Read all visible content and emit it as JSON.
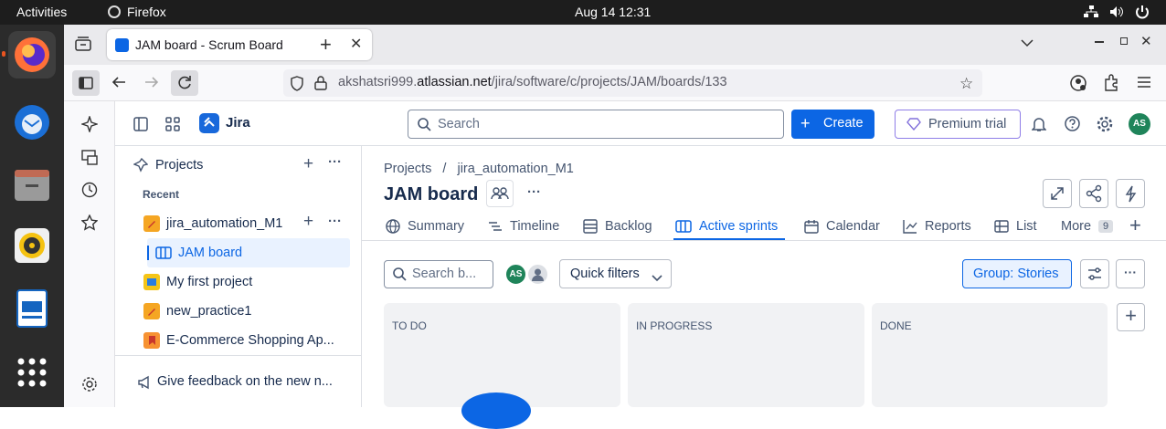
{
  "system": {
    "activities": "Activities",
    "app_name": "Firefox",
    "datetime": "Aug 14  12:31"
  },
  "browser": {
    "tab_title": "JAM board - Scrum Board",
    "url_domain": "akshatsri999.",
    "url_host": "atlassian.net",
    "url_path": "/jira/software/c/projects/JAM/boards/133"
  },
  "jira": {
    "product": "Jira",
    "search_placeholder": "Search",
    "create_label": "Create",
    "premium_label": "Premium trial",
    "avatar_initials": "AS"
  },
  "sidebar": {
    "projects_label": "Projects",
    "recent_label": "Recent",
    "items": [
      {
        "label": "jira_automation_M1",
        "color": "#f5a623"
      },
      {
        "label": "JAM board"
      },
      {
        "label": "My first project",
        "color": "#f5c518"
      },
      {
        "label": "new_practice1",
        "color": "#f5a623"
      },
      {
        "label": "E-Commerce Shopping Ap...",
        "color": "#f79232"
      }
    ],
    "feedback_label": "Give feedback on the new n..."
  },
  "main": {
    "breadcrumb_projects": "Projects",
    "breadcrumb_sep": "/",
    "breadcrumb_project": "jira_automation_M1",
    "title": "JAM board",
    "tabs": [
      "Summary",
      "Timeline",
      "Backlog",
      "Active sprints",
      "Calendar",
      "Reports",
      "List"
    ],
    "more_label": "More",
    "more_count": "9",
    "board_search_placeholder": "Search b...",
    "quick_filters_label": "Quick filters",
    "group_label": "Group: Stories",
    "columns": [
      "TO DO",
      "IN PROGRESS",
      "DONE"
    ],
    "accent": "#0c66e4"
  }
}
